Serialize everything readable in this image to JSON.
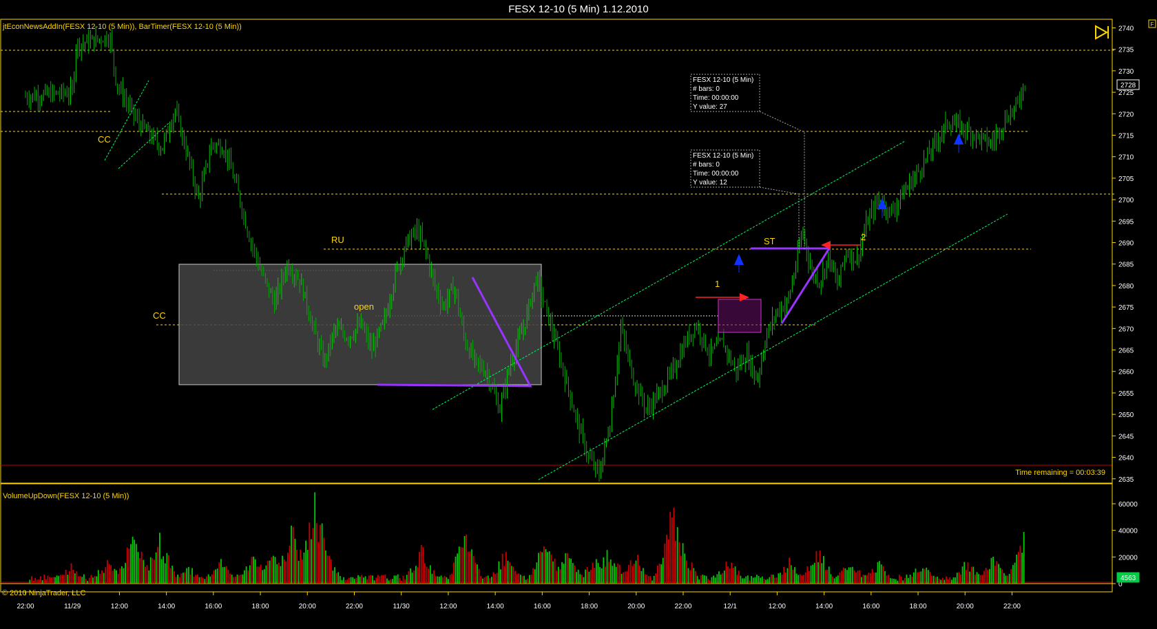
{
  "window": {
    "title": "FESX 12-10 (5 Min)  1.12.2010"
  },
  "indicators_top": "jtEconNewsAddIn(FESX 12-10 (5 Min)), BarTimer(FESX 12-10 (5 Min))",
  "indicators_bottom": "VolumeUpDown(FESX 12-10 (5 Min))",
  "copyright": "© 2010 NinjaTrader, LLC",
  "time_remaining": "Time remaining = 00:03:39",
  "corner_marker": "F",
  "colors": {
    "up": "#00cc00",
    "down": "#cc0000",
    "grid_line": "#ffd700",
    "channel": "#00ff66",
    "triangle": "#9933ff",
    "box": "#bbbbbb"
  },
  "annotations": {
    "cc_top": "CC",
    "cc_mid": "CC",
    "ru": "RU",
    "open": "open",
    "st": "ST",
    "one": "1",
    "two": "2"
  },
  "tooltips": [
    {
      "l1": "FESX 12-10 (5 Min)",
      "l2": "# bars:   0",
      "l3": "Time:     00:00:00",
      "l4": "Y value: 27"
    },
    {
      "l1": "FESX 12-10 (5 Min)",
      "l2": "# bars:   0",
      "l3": "Time:     00:00:00",
      "l4": "Y value: 12"
    }
  ],
  "chart_data": [
    {
      "type": "candlestick",
      "title": "FESX 12-10 (5 Min)  1.12.2010",
      "x_ticks": [
        "22:00",
        "11/29",
        "12:00",
        "14:00",
        "16:00",
        "18:00",
        "20:00",
        "22:00",
        "11/30",
        "12:00",
        "14:00",
        "16:00",
        "18:00",
        "20:00",
        "22:00",
        "12/1",
        "12:00",
        "14:00",
        "16:00",
        "18:00",
        "20:00",
        "22:00"
      ],
      "y_ticks": [
        2635,
        2640,
        2645,
        2650,
        2655,
        2660,
        2665,
        2670,
        2675,
        2680,
        2685,
        2690,
        2695,
        2700,
        2705,
        2710,
        2715,
        2720,
        2725,
        2730,
        2735,
        2740
      ],
      "ylim": [
        2634,
        2742
      ],
      "last_price": "2728",
      "price_path": [
        [
          0.0,
          2724
        ],
        [
          2.2,
          2725
        ],
        [
          2.3,
          2736
        ],
        [
          3.9,
          2738
        ],
        [
          4.2,
          2727
        ],
        [
          5.2,
          2718
        ],
        [
          6.3,
          2712
        ],
        [
          6.9,
          2721
        ],
        [
          7.4,
          2712
        ],
        [
          8.0,
          2700
        ],
        [
          8.6,
          2713
        ],
        [
          9.2,
          2712
        ],
        [
          9.8,
          2702
        ],
        [
          10.3,
          2692
        ],
        [
          10.9,
          2683
        ],
        [
          11.5,
          2676
        ],
        [
          12.1,
          2685
        ],
        [
          12.7,
          2681
        ],
        [
          13.3,
          2670
        ],
        [
          13.8,
          2662
        ],
        [
          14.3,
          2670
        ],
        [
          14.9,
          2668
        ],
        [
          15.5,
          2671
        ],
        [
          16.0,
          2665
        ],
        [
          16.6,
          2672
        ],
        [
          17.1,
          2683
        ],
        [
          17.6,
          2690
        ],
        [
          18.1,
          2693
        ],
        [
          18.5,
          2688
        ],
        [
          18.9,
          2680
        ],
        [
          19.3,
          2675
        ],
        [
          19.8,
          2680
        ],
        [
          20.3,
          2667
        ],
        [
          20.8,
          2662
        ],
        [
          21.3,
          2660
        ],
        [
          21.9,
          2651
        ],
        [
          22.4,
          2662
        ],
        [
          23.0,
          2670
        ],
        [
          23.6,
          2682
        ],
        [
          24.3,
          2670
        ],
        [
          24.9,
          2659
        ],
        [
          25.5,
          2648
        ],
        [
          26.0,
          2640
        ],
        [
          26.5,
          2636
        ],
        [
          27.0,
          2648
        ],
        [
          27.5,
          2670
        ],
        [
          28.1,
          2658
        ],
        [
          28.7,
          2651
        ],
        [
          29.3,
          2655
        ],
        [
          29.9,
          2660
        ],
        [
          30.5,
          2667
        ],
        [
          31.0,
          2671
        ],
        [
          31.6,
          2664
        ],
        [
          32.2,
          2667
        ],
        [
          32.8,
          2660
        ],
        [
          33.3,
          2664
        ],
        [
          33.8,
          2658
        ],
        [
          34.2,
          2668
        ],
        [
          34.7,
          2674
        ],
        [
          35.2,
          2676
        ],
        [
          35.6,
          2685
        ],
        [
          35.9,
          2693
        ],
        [
          36.3,
          2683
        ],
        [
          36.7,
          2681
        ],
        [
          37.1,
          2687
        ],
        [
          37.5,
          2680
        ],
        [
          37.9,
          2688
        ],
        [
          38.4,
          2686
        ],
        [
          38.9,
          2695
        ],
        [
          39.4,
          2700
        ],
        [
          40.0,
          2697
        ],
        [
          40.6,
          2702
        ],
        [
          41.3,
          2707
        ],
        [
          42.0,
          2713
        ],
        [
          42.6,
          2718
        ],
        [
          43.2,
          2717
        ],
        [
          43.9,
          2715
        ],
        [
          44.6,
          2713
        ],
        [
          45.3,
          2719
        ],
        [
          45.8,
          2722
        ],
        [
          46.2,
          2728
        ]
      ],
      "volume": {
        "ylim": [
          0,
          75000
        ],
        "y_ticks": [
          0,
          20000,
          40000,
          60000
        ],
        "last_value": "4563",
        "peaks": [
          {
            "t": 2.1,
            "v": 16000
          },
          {
            "t": 3.8,
            "v": 20000
          },
          {
            "t": 4.5,
            "v": 12000
          },
          {
            "t": 5.0,
            "v": 45000
          },
          {
            "t": 6.2,
            "v": 40000
          },
          {
            "t": 7.5,
            "v": 15000
          },
          {
            "t": 9.0,
            "v": 20000
          },
          {
            "t": 10.5,
            "v": 25000
          },
          {
            "t": 11.5,
            "v": 30000
          },
          {
            "t": 12.3,
            "v": 47000
          },
          {
            "t": 13.4,
            "v": 72000
          },
          {
            "t": 13.9,
            "v": 25000
          },
          {
            "t": 18.3,
            "v": 30000
          },
          {
            "t": 20.3,
            "v": 42000
          },
          {
            "t": 22.2,
            "v": 28000
          },
          {
            "t": 24.0,
            "v": 38000
          },
          {
            "t": 25.0,
            "v": 26000
          },
          {
            "t": 26.3,
            "v": 22000
          },
          {
            "t": 27.0,
            "v": 30000
          },
          {
            "t": 28.2,
            "v": 25000
          },
          {
            "t": 29.9,
            "v": 68000
          },
          {
            "t": 30.3,
            "v": 35000
          },
          {
            "t": 32.5,
            "v": 22000
          },
          {
            "t": 35.3,
            "v": 20000
          },
          {
            "t": 36.6,
            "v": 32000
          },
          {
            "t": 38.1,
            "v": 20000
          },
          {
            "t": 39.4,
            "v": 18000
          },
          {
            "t": 41.4,
            "v": 18000
          },
          {
            "t": 43.5,
            "v": 20000
          },
          {
            "t": 44.7,
            "v": 22000
          },
          {
            "t": 46.1,
            "v": 48000
          }
        ]
      }
    }
  ]
}
